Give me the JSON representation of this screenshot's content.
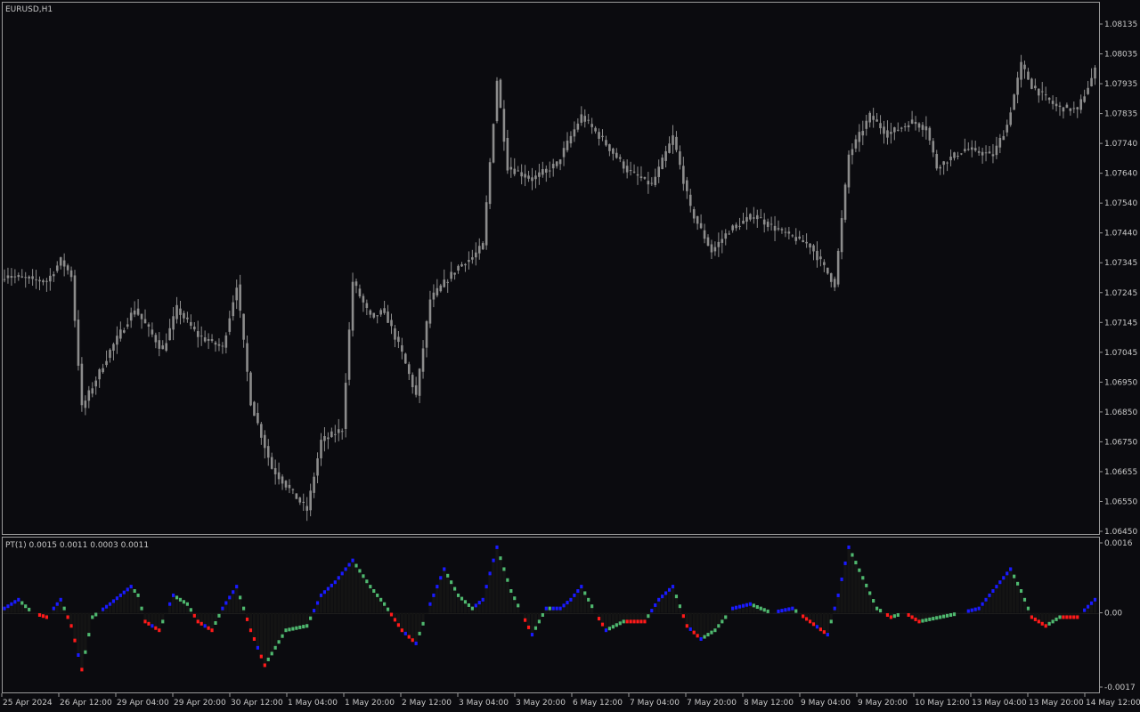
{
  "window": {
    "symbol_label": "EURUSD,H1"
  },
  "indicator": {
    "label": "PT(1) 0.0015 0.0011 0.0003 0.0011"
  },
  "colors": {
    "background": "#0b0b0f",
    "border": "#9a9a9a",
    "candle": "#8c8c8c",
    "hist_neutral": "#141414",
    "red": "#ff1a1a",
    "blue": "#1a1aff",
    "green": "#4fb86f",
    "text": "#c8c8c8"
  },
  "chart_data": [
    {
      "type": "candlestick",
      "title": "EURUSD,H1",
      "ylim": [
        0.0645,
        0.08135
      ],
      "y_ticks": [
        "1.08135",
        "1.08035",
        "1.07935",
        "1.07835",
        "1.07740",
        "1.07640",
        "1.07540",
        "1.07440",
        "1.07345",
        "1.07245",
        "1.07145",
        "1.07045",
        "1.06950",
        "1.06850",
        "1.06750",
        "1.06655",
        "1.06550",
        "1.06450"
      ],
      "close_keypoints": [
        [
          0,
          0.073
        ],
        [
          12,
          0.0728
        ],
        [
          16,
          0.0735
        ],
        [
          19,
          0.073
        ],
        [
          22,
          0.0686
        ],
        [
          30,
          0.0705
        ],
        [
          37,
          0.0719
        ],
        [
          45,
          0.0705
        ],
        [
          49,
          0.0719
        ],
        [
          55,
          0.071
        ],
        [
          62,
          0.0706
        ],
        [
          66,
          0.0727
        ],
        [
          70,
          0.0688
        ],
        [
          76,
          0.0666
        ],
        [
          86,
          0.0652
        ],
        [
          90,
          0.0675
        ],
        [
          96,
          0.0679
        ],
        [
          99,
          0.0728
        ],
        [
          104,
          0.0716
        ],
        [
          108,
          0.0718
        ],
        [
          113,
          0.0704
        ],
        [
          117,
          0.069
        ],
        [
          121,
          0.0722
        ],
        [
          129,
          0.0733
        ],
        [
          133,
          0.0736
        ],
        [
          136,
          0.074
        ],
        [
          140,
          0.0795
        ],
        [
          143,
          0.0766
        ],
        [
          150,
          0.0762
        ],
        [
          157,
          0.0767
        ],
        [
          164,
          0.0783
        ],
        [
          170,
          0.0775
        ],
        [
          177,
          0.0765
        ],
        [
          184,
          0.076
        ],
        [
          190,
          0.0776
        ],
        [
          195,
          0.0752
        ],
        [
          201,
          0.0738
        ],
        [
          206,
          0.0745
        ],
        [
          213,
          0.075
        ],
        [
          220,
          0.0745
        ],
        [
          229,
          0.074
        ],
        [
          236,
          0.0727
        ],
        [
          240,
          0.077
        ],
        [
          246,
          0.0783
        ],
        [
          251,
          0.0777
        ],
        [
          258,
          0.0781
        ],
        [
          262,
          0.0779
        ],
        [
          265,
          0.0766
        ],
        [
          273,
          0.0772
        ],
        [
          281,
          0.077
        ],
        [
          285,
          0.078
        ],
        [
          289,
          0.08
        ],
        [
          292,
          0.0793
        ],
        [
          299,
          0.0786
        ],
        [
          305,
          0.0785
        ],
        [
          310,
          0.0798
        ]
      ]
    },
    {
      "type": "histogram",
      "title": "PT(1) 0.0015 0.0011 0.0003 0.0011",
      "ylim": [
        -0.0017,
        0.0016
      ],
      "y_ticks": [
        "0.0016",
        "0.00",
        "-0.0017"
      ],
      "x_ticks": [
        "25 Apr 2024",
        "26 Apr 12:00",
        "29 Apr 04:00",
        "29 Apr 20:00",
        "30 Apr 12:00",
        "1 May 04:00",
        "1 May 20:00",
        "2 May 12:00",
        "3 May 04:00",
        "3 May 20:00",
        "6 May 12:00",
        "7 May 04:00",
        "7 May 20:00",
        "8 May 12:00",
        "9 May 04:00",
        "9 May 20:00",
        "10 May 12:00",
        "13 May 04:00",
        "13 May 20:00",
        "14 May 12:00"
      ],
      "value_keypoints": [
        [
          0,
          0.0001
        ],
        [
          4,
          0.0003
        ],
        [
          8,
          0.0
        ],
        [
          12,
          -0.0001
        ],
        [
          16,
          0.0003
        ],
        [
          19,
          -0.0003
        ],
        [
          22,
          -0.0013
        ],
        [
          25,
          -0.0001
        ],
        [
          30,
          0.0002
        ],
        [
          36,
          0.0006
        ],
        [
          38,
          0.0004
        ],
        [
          40,
          -0.0002
        ],
        [
          44,
          -0.0004
        ],
        [
          48,
          0.0004
        ],
        [
          52,
          0.0002
        ],
        [
          55,
          -0.0002
        ],
        [
          59,
          -0.0004
        ],
        [
          62,
          0.0001
        ],
        [
          66,
          0.0006
        ],
        [
          70,
          -0.0004
        ],
        [
          74,
          -0.0012
        ],
        [
          80,
          -0.0004
        ],
        [
          86,
          -0.0003
        ],
        [
          90,
          0.0004
        ],
        [
          94,
          0.0007
        ],
        [
          99,
          0.0012
        ],
        [
          104,
          0.0006
        ],
        [
          108,
          0.0002
        ],
        [
          113,
          -0.0004
        ],
        [
          117,
          -0.0007
        ],
        [
          121,
          0.0002
        ],
        [
          125,
          0.001
        ],
        [
          129,
          0.0004
        ],
        [
          133,
          0.0001
        ],
        [
          136,
          0.0003
        ],
        [
          140,
          0.0015
        ],
        [
          144,
          0.0005
        ],
        [
          147,
          0.0
        ],
        [
          150,
          -0.0005
        ],
        [
          154,
          0.0001
        ],
        [
          158,
          0.0001
        ],
        [
          161,
          0.0003
        ],
        [
          164,
          0.0006
        ],
        [
          168,
          0.0
        ],
        [
          171,
          -0.0004
        ],
        [
          176,
          -0.0002
        ],
        [
          182,
          -0.0002
        ],
        [
          186,
          0.0003
        ],
        [
          190,
          0.0006
        ],
        [
          194,
          -0.0003
        ],
        [
          198,
          -0.0006
        ],
        [
          202,
          -0.0004
        ],
        [
          207,
          0.0001
        ],
        [
          212,
          0.0002
        ],
        [
          218,
          0.0
        ],
        [
          224,
          0.0001
        ],
        [
          229,
          -0.0002
        ],
        [
          234,
          -0.0005
        ],
        [
          237,
          0.0004
        ],
        [
          240,
          0.0015
        ],
        [
          244,
          0.0008
        ],
        [
          248,
          0.0001
        ],
        [
          252,
          -0.0001
        ],
        [
          256,
          0.0
        ],
        [
          260,
          -0.0002
        ],
        [
          266,
          -0.0001
        ],
        [
          272,
          0.0
        ],
        [
          277,
          0.0001
        ],
        [
          283,
          0.0007
        ],
        [
          286,
          0.001
        ],
        [
          289,
          0.0005
        ],
        [
          292,
          -0.0001
        ],
        [
          296,
          -0.0003
        ],
        [
          300,
          -0.0001
        ],
        [
          305,
          -0.0001
        ],
        [
          310,
          0.0003
        ]
      ]
    }
  ]
}
